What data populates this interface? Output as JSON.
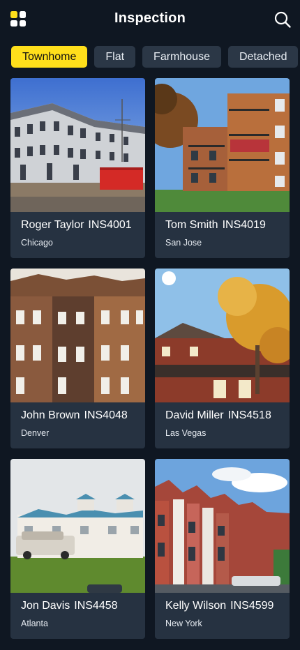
{
  "header": {
    "title": "Inspection",
    "menu_icon": "grid-menu-icon",
    "search_icon": "search-icon",
    "icon_colors": [
      "#ffdf1b",
      "#ffffff",
      "#ffffff",
      "#ffffff"
    ]
  },
  "filters": [
    {
      "label": "Townhome",
      "active": true
    },
    {
      "label": "Flat",
      "active": false
    },
    {
      "label": "Farmhouse",
      "active": false
    },
    {
      "label": "Detached",
      "active": false
    }
  ],
  "colors": {
    "background": "#0f1722",
    "card": "#263241",
    "chip": "#2b3746",
    "accent": "#ffdf1b"
  },
  "inspections": [
    {
      "name": "Roger Taylor",
      "code": "INS4001",
      "city": "Chicago",
      "photo": "townhouse-row-construction"
    },
    {
      "name": "Tom Smith",
      "code": "INS4019",
      "city": "San Jose",
      "photo": "apartment-balconies"
    },
    {
      "name": "John Brown",
      "code": "INS4048",
      "city": "Denver",
      "photo": "old-brick-townhouses"
    },
    {
      "name": "David Miller",
      "code": "INS4518",
      "city": "Las Vegas",
      "photo": "brick-house-autumn-tree"
    },
    {
      "name": "Jon Davis",
      "code": "INS4458",
      "city": "Atlanta",
      "photo": "beach-townhomes"
    },
    {
      "name": "Kelly Wilson",
      "code": "INS4599",
      "city": "New York",
      "photo": "victorian-terrace-street"
    }
  ]
}
